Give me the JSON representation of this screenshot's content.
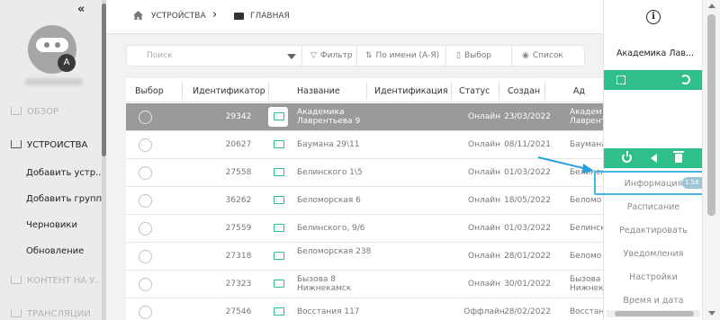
{
  "sidebar": {
    "avatar_letter": "A",
    "items": [
      {
        "label": "ОБЗОР",
        "icon": "overview-icon"
      },
      {
        "label": "УСТРОЙСТВА",
        "icon": "monitor-icon"
      },
      {
        "label": "Добавить устр..."
      },
      {
        "label": "Добавить группу"
      },
      {
        "label": "Черновики"
      },
      {
        "label": "Обновление"
      },
      {
        "label": "КОНТЕНТ НА У...",
        "icon": "content-icon"
      },
      {
        "label": "ТРАНСЛЯЦИИ",
        "icon": "broadcast-icon"
      }
    ]
  },
  "breadcrumb": {
    "devices": "УСТРОЙСТВА",
    "main": "ГЛАВНАЯ"
  },
  "toolbar": {
    "search_placeholder": "Поиск",
    "filter": "Фильтр",
    "sort": "По имени (А-Я)",
    "select": "Выбор",
    "list": "Список"
  },
  "table": {
    "headers": [
      "Выбор",
      "Идентификатор",
      "Название",
      "Идентификация",
      "Статус",
      "Создан",
      "Ад"
    ],
    "rows": [
      {
        "id": "29342",
        "name": "Академика Лаврентьева 9",
        "status": "Онлайн",
        "created": "23/03/2022",
        "addr": "Академ Лаврент",
        "selected": true
      },
      {
        "id": "20627",
        "name": "Баумана 29\\11",
        "status": "Онлайн",
        "created": "08/11/2021",
        "addr": "Баумана",
        "selected": false
      },
      {
        "id": "27558",
        "name": "Белинского 1\\5",
        "status": "Онлайн",
        "created": "01/03/2022",
        "addr": "Белинск",
        "selected": false
      },
      {
        "id": "36262",
        "name": "Беломорская 6",
        "status": "Онлайн",
        "created": "18/05/2022",
        "addr": "Беломо",
        "selected": false
      },
      {
        "id": "27559",
        "name": "Белинского, 9/6",
        "status": "Онлайн",
        "created": "01/03/2022",
        "addr": "Белинск",
        "selected": false
      },
      {
        "id": "27318",
        "name": "Беломорская 238",
        "status": "Онлайн",
        "created": "28/01/2022",
        "addr": "Беломо",
        "selected": false
      },
      {
        "id": "27323",
        "name": "Бызова 8 Нижнекамск",
        "status": "Онлайн",
        "created": "30/01/2022",
        "addr": "Бызова Нижнека",
        "selected": false
      },
      {
        "id": "27546",
        "name": "Восстания 117",
        "status": "Оффлайн",
        "created": "28/02/2022",
        "addr": "Восстан",
        "selected": false
      }
    ]
  },
  "panel": {
    "title": "Академика Лав...",
    "menu": [
      "Информация",
      "Расписание",
      "Редактировать",
      "Уведомления",
      "Настройки",
      "Время и дата"
    ],
    "badge": "1.58",
    "accent": "#2fbf8a",
    "highlight": "#43b4e6"
  }
}
